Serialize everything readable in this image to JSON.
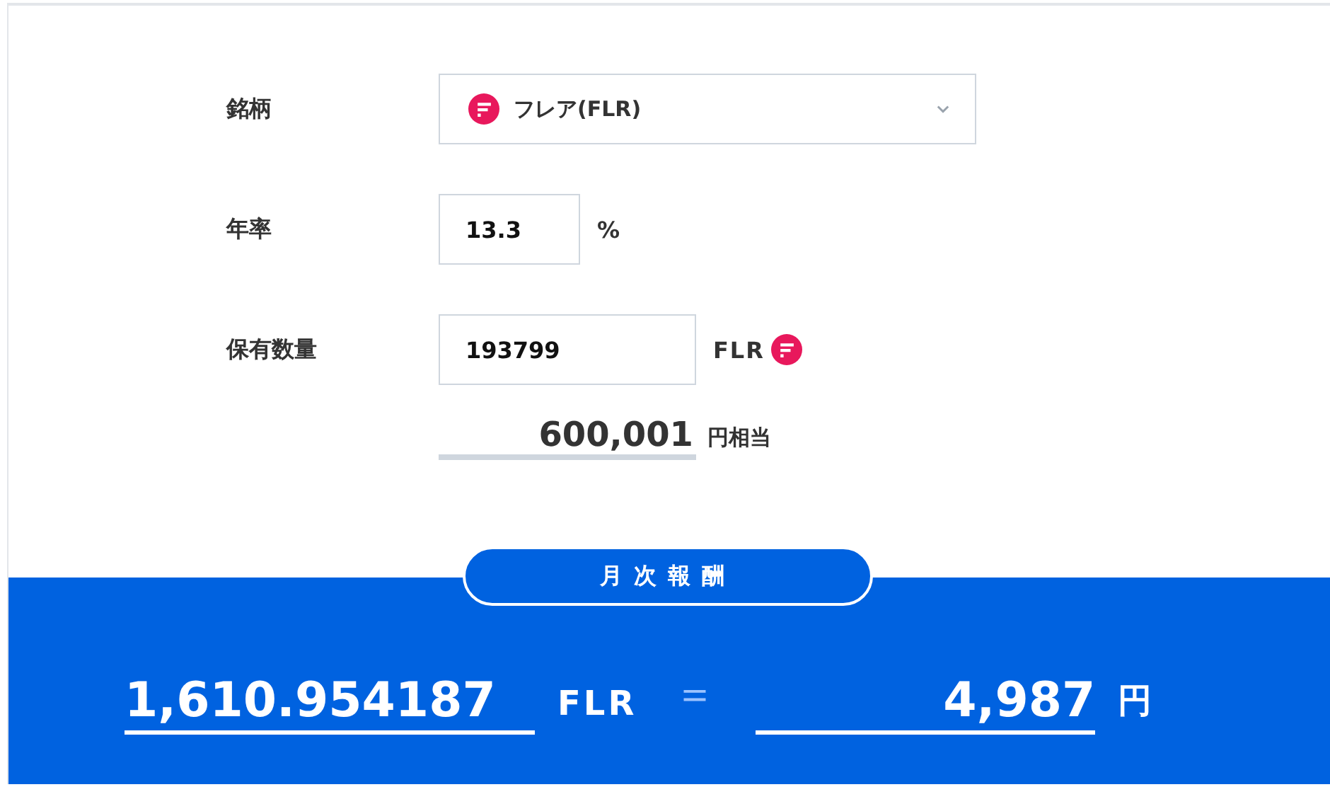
{
  "form": {
    "rows": [
      {
        "kind": "select",
        "label": "銘柄",
        "value": "フレア(FLR)",
        "icon": true
      },
      {
        "kind": "input",
        "label": "年率",
        "value": "13.3",
        "unit": "%"
      },
      {
        "kind": "input",
        "label": "保有数量",
        "value": "193799",
        "unit": "FLR",
        "icon": true
      }
    ],
    "equivalent": {
      "value": "600,001",
      "unit": "円相当"
    }
  },
  "result": {
    "heading": "月次報酬",
    "amount": "1,610.954187",
    "amount_unit": "FLR",
    "equals": "＝",
    "yen": "4,987",
    "yen_unit": "円"
  }
}
